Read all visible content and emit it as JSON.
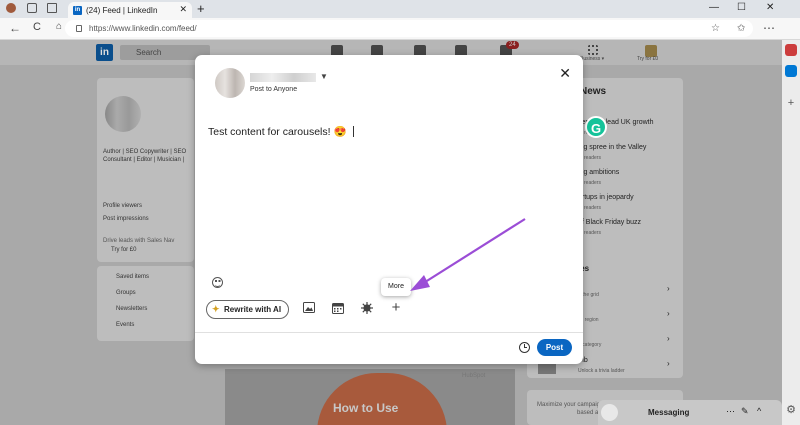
{
  "browser": {
    "tab_title": "(24) Feed | LinkedIn",
    "tab_favicon": "in",
    "url": "https://www.linkedin.com/feed/",
    "new_tab": "+",
    "close_tab": "✕",
    "back": "←",
    "reload": "C",
    "window_minimize": "—",
    "window_maximize": "☐",
    "window_close": "✕"
  },
  "linkedin": {
    "logo": "in",
    "search_placeholder": "Search",
    "notification_count": "24",
    "nav_business": "Business ▾",
    "premium": "Try for £0",
    "profile_headline_1": "Author | SEO Copywriter | SEO",
    "profile_headline_2": "Consultant | Editor | Musician |",
    "profile_viewers": "Profile viewers",
    "post_impressions": "Post impressions",
    "drive_leads": "Drive leads with Sales Nav",
    "try_free": "Try for £0",
    "saved_items": "Saved items",
    "groups": "Groups",
    "newsletters": "Newsletters",
    "events": "Events",
    "news_title": "News",
    "news": [
      {
        "title": "services lead UK growth",
        "sub": "readers"
      },
      {
        "title": "ing spree in the Valley",
        "sub": "readers"
      },
      {
        "title": "ing ambitions",
        "sub": "readers"
      },
      {
        "title": "artups in jeopardy",
        "sub": "readers"
      },
      {
        "title": "of Black Friday buzz",
        "sub": "readers"
      }
    ],
    "games_title": "les",
    "games": [
      {
        "title": "",
        "sub": "e the grid"
      },
      {
        "title": "",
        "sub": "ch region"
      },
      {
        "title": "",
        "sub": "e category"
      },
      {
        "title": "mb",
        "sub": "Unlock a trivia ladder"
      }
    ],
    "howto_text": "How to Use",
    "hubspot": "HubSpot",
    "messaging": "Messaging",
    "ad_line_1": "Maximize your campaign's impa",
    "ad_line_2": "based advertisi"
  },
  "modal": {
    "post_to": "Post to Anyone",
    "close_label": "✕",
    "post_text": "Test content for carousels! 😍",
    "rewrite_label": "Rewrite with AI",
    "more_tooltip": "More",
    "post_button": "Post",
    "icons": {
      "image": "image-icon",
      "calendar": "calendar-icon",
      "gear": "celebrate-icon",
      "plus": "plus-icon",
      "clock": "schedule-icon"
    }
  },
  "colors": {
    "linkedin_blue": "#0a66c2",
    "arrow_purple": "#9b4dd6",
    "grammarly_green": "#15c39a"
  }
}
